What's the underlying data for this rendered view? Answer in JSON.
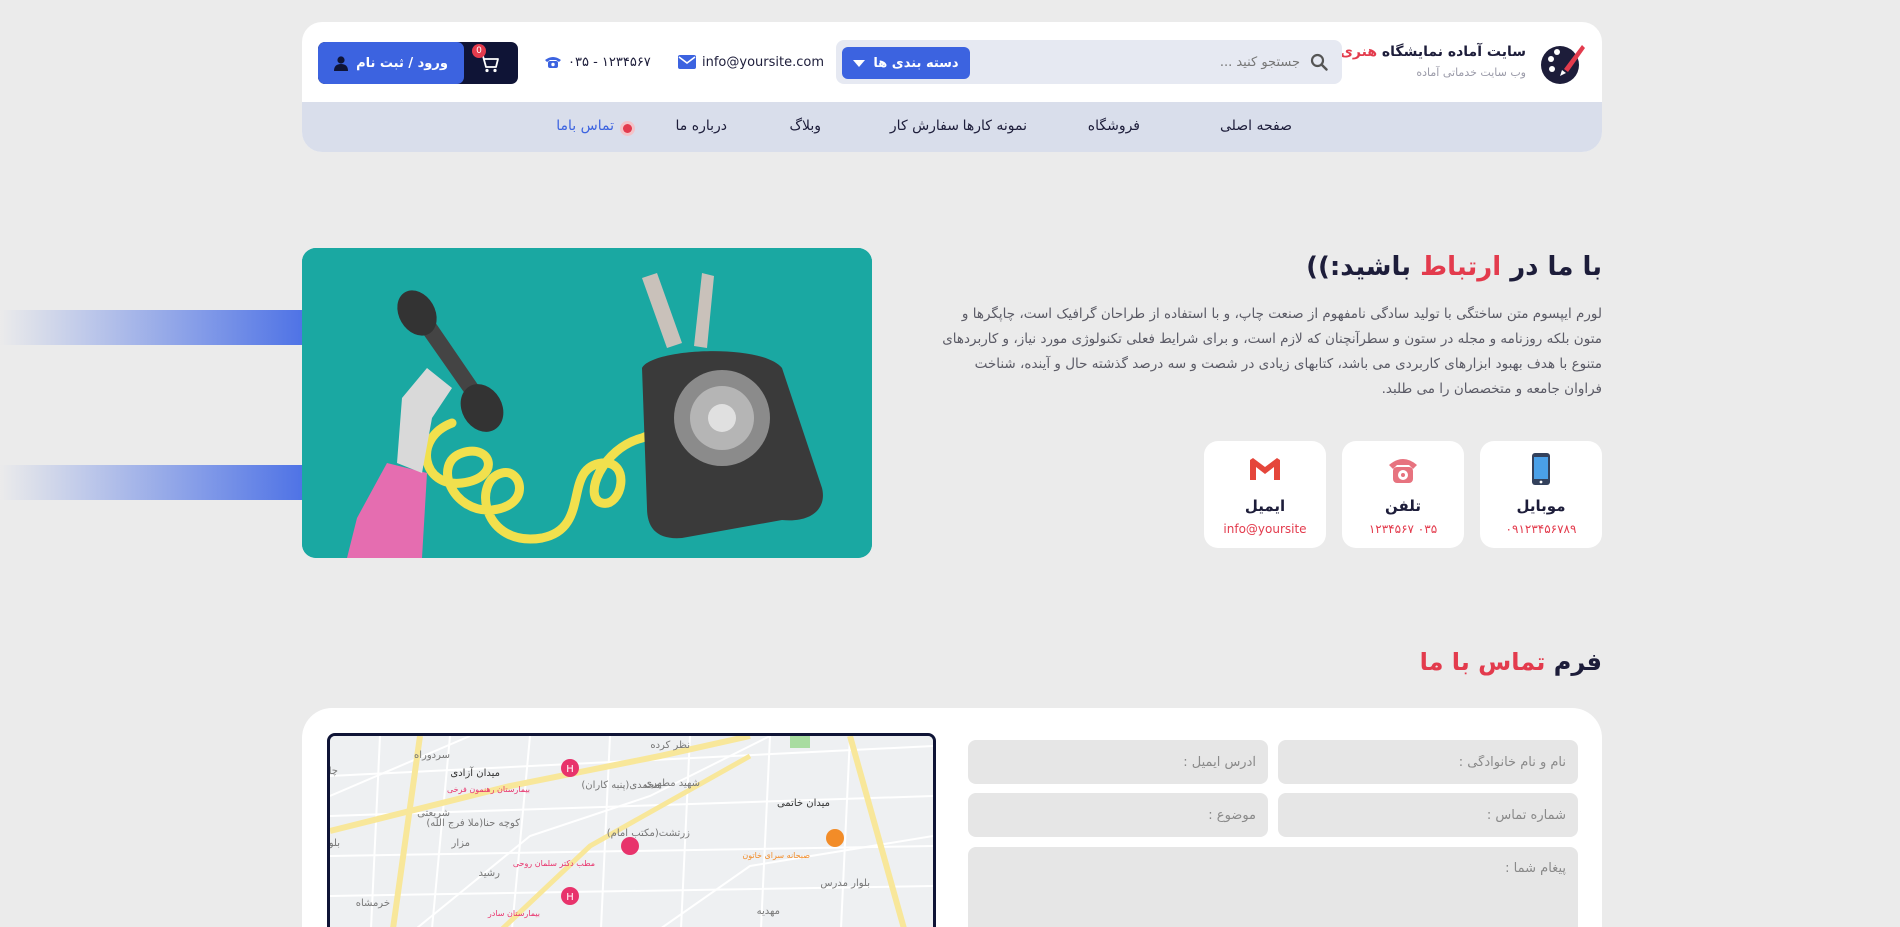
{
  "brand": {
    "title_main": "سایت آماده نمایشگاه",
    "title_accent": "هنری",
    "subtitle": "وب سایت خدماتی آماده"
  },
  "search": {
    "placeholder": "جستجو کنید ..."
  },
  "category_button": "دسته بندی ها",
  "contact_info": {
    "email": "info@yoursite.com",
    "phone": "۰۳۵ - ۱۲۳۴۵۶۷"
  },
  "login": {
    "label": "ورود / ثبت نام",
    "cart_count": "0"
  },
  "nav": {
    "items": [
      "صفحه اصلی",
      "فروشگاه",
      "نمونه کارها",
      "سفارش کار",
      "وبلاگ",
      "درباره ما",
      "تماس باما"
    ],
    "active_index": 6
  },
  "hero": {
    "title_before": "با ما در",
    "title_accent": "ارتباط",
    "title_after": "باشید:))",
    "text": "لورم ایپسوم متن ساختگی با تولید سادگی نامفهوم از صنعت چاپ، و با استفاده از طراحان گرافیک است، چاپگرها و متون بلکه روزنامه و مجله در ستون و سطرآنچنان که لازم است، و برای شرایط فعلی تکنولوژی مورد نیاز، و کاربردهای متنوع با هدف بهبود ابزارهای کاربردی می باشد، کتابهای زیادی در شصت و سه درصد گذشته حال و آینده، شناخت فراوان جامعه و متخصصان را می طلبد."
  },
  "cards": [
    {
      "title": "موبایل",
      "value": "۰۹۱۲۳۴۵۶۷۸۹",
      "icon": "mobile-icon"
    },
    {
      "title": "تلفن",
      "value": "۰۳۵ ۱۲۳۴۵۶۷",
      "icon": "telephone-icon"
    },
    {
      "title": "ایمیل",
      "value": "info@yoursite",
      "icon": "gmail-icon"
    }
  ],
  "form": {
    "title_before": "فرم",
    "title_accent": "تماس با ما",
    "name_placeholder": "نام و نام خانوادگی :",
    "email_placeholder": "آدرس ایمیل :",
    "phone_placeholder": "شماره تماس :",
    "subject_placeholder": "موضوع :",
    "message_placeholder": "پیغام شما :"
  },
  "map": {
    "labels": [
      "نظر کرده",
      "سردوراه",
      "چاه قلیه",
      "میدان آزادی",
      "بیمارستان رهنمون فرخی",
      "شهید مطهری",
      "محمدی(پنبه کاران)",
      "میدان خاتمی",
      "کوچه حنا(ملا فرج الله)",
      "زرتشت(مکتب امام)",
      "صبحانه سرای خاتون",
      "مطب دکتر سلمان روحی",
      "بیمارستان سادر",
      "خرمشاه",
      "بلوار شهید باهنر",
      "بلوار مدرس",
      "مزار",
      "شریعتی",
      "رشید",
      "مهدیه"
    ]
  },
  "colors": {
    "accent": "#3c63e0",
    "brand_red": "#e33b4d",
    "navy": "#0f1436"
  }
}
